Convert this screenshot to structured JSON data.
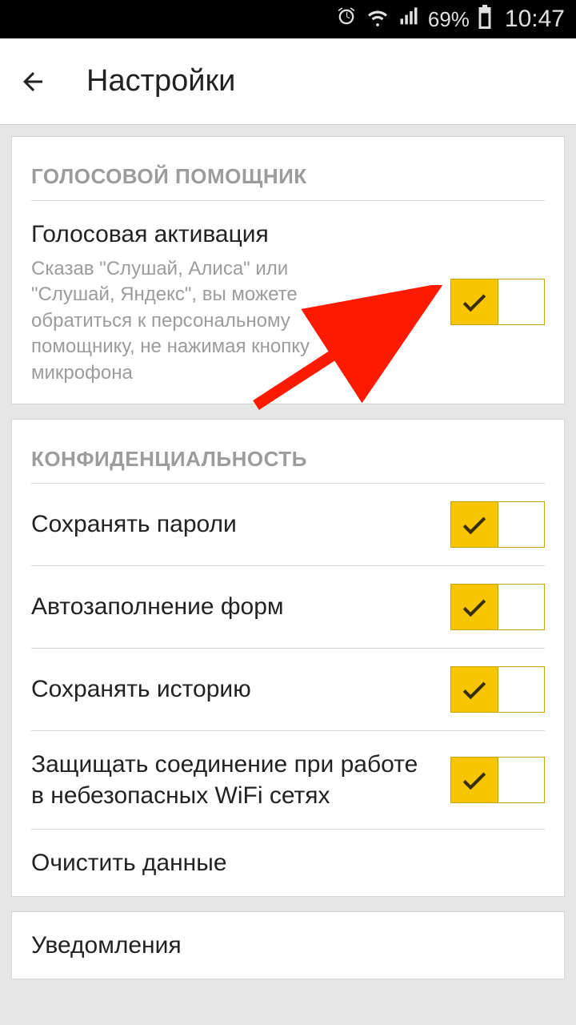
{
  "statusbar": {
    "battery_pct": "69%",
    "time": "10:47"
  },
  "header": {
    "title": "Настройки"
  },
  "sections": {
    "voice": {
      "header": "ГОЛОСОВОЙ ПОМОЩНИК",
      "items": [
        {
          "title": "Голосовая активация",
          "desc": "Сказав \"Слушай, Алиса\" или \"Слушай, Яндекс\", вы можете обратиться к персональному помощнику, не нажимая кнопку микрофона",
          "toggle": true
        }
      ]
    },
    "privacy": {
      "header": "КОНФИДЕНЦИАЛЬНОСТЬ",
      "items": [
        {
          "title": "Сохранять пароли",
          "toggle": true
        },
        {
          "title": "Автозаполнение форм",
          "toggle": true
        },
        {
          "title": "Сохранять историю",
          "toggle": true
        },
        {
          "title": "Защищать соединение при работе в небезопасных WiFi сетях",
          "toggle": true
        },
        {
          "title": "Очистить данные",
          "toggle": null
        }
      ]
    },
    "next": {
      "items": [
        {
          "title": "Уведомления",
          "toggle": null
        }
      ]
    }
  }
}
